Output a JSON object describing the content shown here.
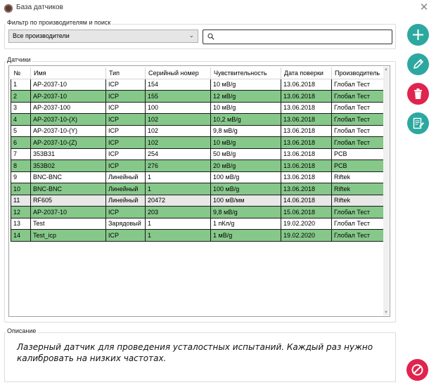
{
  "window": {
    "title": "База датчиков"
  },
  "filter": {
    "group_label": "Фильтр по производителям и поиск",
    "manufacturer_selected": "Все производители",
    "search_value": "",
    "search_placeholder": ""
  },
  "sensors": {
    "group_label": "Датчики",
    "columns": [
      "№",
      "Имя",
      "Тип",
      "Серийный номер",
      "Чувствительность",
      "Дата поверки",
      "Производитель"
    ],
    "rows": [
      {
        "n": "1",
        "name": "AP-2037-10",
        "type": "ICP",
        "serial": "154",
        "sens": "10 мВ/g",
        "date": "13.06.2018",
        "maker": "Глобал Тест",
        "style": "white"
      },
      {
        "n": "2",
        "name": "AP-2037-10",
        "type": "ICP",
        "serial": "155",
        "sens": "12 мВ/g",
        "date": "13.06.2018",
        "maker": "Глобал Тест",
        "style": "green"
      },
      {
        "n": "3",
        "name": "AP-2037-100",
        "type": "ICP",
        "serial": "100",
        "sens": "10 мВ/g",
        "date": "13.06.2018",
        "maker": "Глобал Тест",
        "style": "white"
      },
      {
        "n": "4",
        "name": "AP-2037-10-(X)",
        "type": "ICP",
        "serial": "102",
        "sens": "10,2 мВ/g",
        "date": "13.06.2018",
        "maker": "Глобал Тест",
        "style": "green"
      },
      {
        "n": "5",
        "name": "AP-2037-10-(Y)",
        "type": "ICP",
        "serial": "102",
        "sens": "9,8 мВ/g",
        "date": "13.06.2018",
        "maker": "Глобал Тест",
        "style": "white"
      },
      {
        "n": "6",
        "name": "AP-2037-10-(Z)",
        "type": "ICP",
        "serial": "102",
        "sens": "10 мВ/g",
        "date": "13.06.2018",
        "maker": "Глобал Тест",
        "style": "green"
      },
      {
        "n": "7",
        "name": "353B31",
        "type": "ICP",
        "serial": "254",
        "sens": "50 мВ/g",
        "date": "13.06.2018",
        "maker": "PCB",
        "style": "white"
      },
      {
        "n": "8",
        "name": "353B02",
        "type": "ICP",
        "serial": "276",
        "sens": "20 мВ/g",
        "date": "13.06.2018",
        "maker": "PCB",
        "style": "green"
      },
      {
        "n": "9",
        "name": "BNC-BNC",
        "type": "Линейный",
        "serial": "1",
        "sens": "100 мВ/g",
        "date": "13.06.2018",
        "maker": "Riftek",
        "style": "white"
      },
      {
        "n": "10",
        "name": "BNC-BNC",
        "type": "Линейный",
        "serial": "1",
        "sens": "100 мВ/g",
        "date": "13.06.2018",
        "maker": "Riftek",
        "style": "green"
      },
      {
        "n": "11",
        "name": "RF605",
        "type": "Линейный",
        "serial": "20472",
        "sens": "100 мВ/мм",
        "date": "14.06.2018",
        "maker": "Riftek",
        "style": "gray"
      },
      {
        "n": "12",
        "name": "AP-2037-10",
        "type": "ICP",
        "serial": "203",
        "sens": "9,8 мВ/g",
        "date": "15.06.2018",
        "maker": "Глобал Тест",
        "style": "green"
      },
      {
        "n": "13",
        "name": "Test",
        "type": "Зарядовый",
        "serial": "1",
        "sens": "1 пКл/g",
        "date": "19.02.2020",
        "maker": "Глобал Тест",
        "style": "white"
      },
      {
        "n": "14",
        "name": "Test_icp",
        "type": "ICP",
        "serial": "1",
        "sens": "1 мВ/g",
        "date": "19.02.2020",
        "maker": "Глобал Тест",
        "style": "green"
      }
    ]
  },
  "description": {
    "group_label": "Описание",
    "text": "Лазерный датчик для проведения усталостных испытаний. Каждый раз нужно калибровать на низких частотах."
  },
  "actions": {
    "add_icon": "plus-icon",
    "edit_icon": "pencil-icon",
    "delete_icon": "trash-icon",
    "notes_icon": "document-edit-icon",
    "cancel_icon": "prohibited-icon"
  },
  "colors": {
    "row_green": "#86c88a",
    "row_gray": "#e8e8e8",
    "button_teal": "#2da8a0",
    "button_red": "#e0244d"
  }
}
